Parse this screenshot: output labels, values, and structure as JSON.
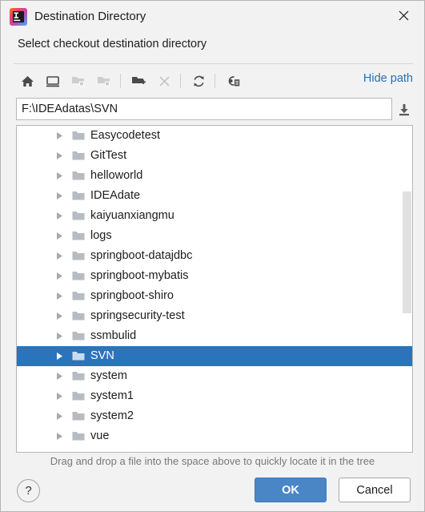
{
  "window": {
    "title": "Destination Directory",
    "app_icon": "intellij-idea-logo",
    "close_icon": "close-icon"
  },
  "header": {
    "subtitle": "Select checkout destination directory"
  },
  "toolbar": {
    "buttons": [
      {
        "name": "home-icon",
        "tooltip": "Home",
        "enabled": true
      },
      {
        "name": "desktop-icon",
        "tooltip": "Desktop",
        "enabled": true
      },
      {
        "name": "collapse-folder-icon",
        "tooltip": "Collapse All",
        "enabled": false
      },
      {
        "name": "expand-folder-icon",
        "tooltip": "Expand All",
        "enabled": false
      },
      {
        "name": "new-folder-icon",
        "tooltip": "New Folder",
        "enabled": true
      },
      {
        "name": "delete-icon",
        "tooltip": "Delete",
        "enabled": false
      },
      {
        "name": "refresh-icon",
        "tooltip": "Refresh",
        "enabled": true
      },
      {
        "name": "show-hidden-files-icon",
        "tooltip": "Show Hidden Files",
        "enabled": true
      }
    ],
    "hide_path_label": "Hide path"
  },
  "path": {
    "value": "F:\\IDEAdatas\\SVN",
    "placeholder": "",
    "download_icon": "download-icon"
  },
  "tree": {
    "items": [
      {
        "label": "Easycodetest",
        "selected": false
      },
      {
        "label": "GitTest",
        "selected": false
      },
      {
        "label": "helloworld",
        "selected": false
      },
      {
        "label": "IDEAdate",
        "selected": false
      },
      {
        "label": "kaiyuanxiangmu",
        "selected": false
      },
      {
        "label": "logs",
        "selected": false
      },
      {
        "label": "springboot-datajdbc",
        "selected": false
      },
      {
        "label": "springboot-mybatis",
        "selected": false
      },
      {
        "label": "springboot-shiro",
        "selected": false
      },
      {
        "label": "springsecurity-test",
        "selected": false
      },
      {
        "label": "ssmbulid",
        "selected": false
      },
      {
        "label": "SVN",
        "selected": true
      },
      {
        "label": "system",
        "selected": false
      },
      {
        "label": "system1",
        "selected": false
      },
      {
        "label": "system2",
        "selected": false
      },
      {
        "label": "vue",
        "selected": false
      }
    ],
    "selected_label": "SVN",
    "selection_color": "#2b74bc"
  },
  "hint": {
    "text": "Drag and drop a file into the space above to quickly locate it in the tree"
  },
  "footer": {
    "help_label": "?",
    "ok_label": "OK",
    "cancel_label": "Cancel",
    "ok_color": "#4a86c5"
  }
}
